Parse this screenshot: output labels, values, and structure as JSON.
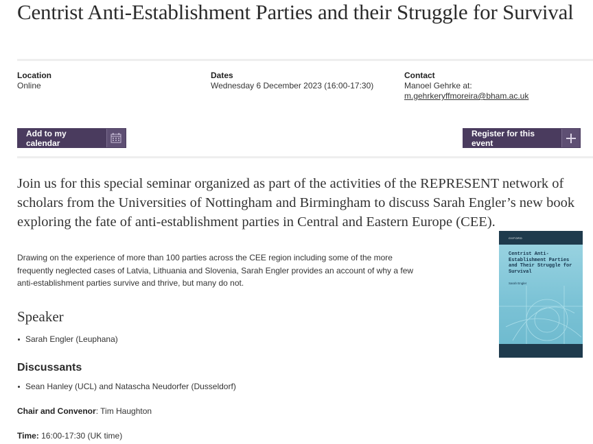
{
  "page": {
    "title": "Centrist Anti-Establishment Parties and their Struggle for Survival"
  },
  "meta": {
    "location_label": "Location",
    "location_value": "Online",
    "dates_label": "Dates",
    "dates_value": "Wednesday 6 December 2023 (16:00-17:30)",
    "contact_label": "Contact",
    "contact_name": "Manoel Gehrke at:",
    "contact_email": "m.gehrkeryffmoreira@bham.ac.uk"
  },
  "actions": {
    "calendar_label": "Add to my calendar",
    "calendar_icon": "calendar-icon",
    "register_label": "Register for this event",
    "register_icon": "plus-icon"
  },
  "content": {
    "lead": "Join us for this special seminar organized as part of the activities of the REPRESENT network of scholars from the Universities of Nottingham and Birmingham to discuss Sarah Engler’s new book exploring the fate of anti-establishment parties in Central and Eastern Europe (CEE).",
    "body": "Drawing on the experience of more than 100 parties across the CEE region including some of the more frequently neglected cases of Latvia, Lithuania and Slovenia, Sarah Engler provides an account of why a few anti-establishment parties survive and thrive, but many do not."
  },
  "book_cover": {
    "publisher": "OXFORD",
    "title": "Centrist Anti-Establishment Parties and Their Struggle for Survival",
    "author": "Sarah Engler",
    "series": "COMPARATIVE POLITICS"
  },
  "speaker": {
    "heading": "Speaker",
    "items": [
      "Sarah Engler (Leuphana)"
    ]
  },
  "discussants": {
    "heading": "Discussants",
    "items": [
      "Sean Hanley (UCL) and Natascha Neudorfer (Dusseldorf)"
    ]
  },
  "chair": {
    "label": "Chair and Convenor",
    "value": ": Tim Haughton"
  },
  "time": {
    "label": "Time:",
    "value": " 16:00-17:30 (UK time)"
  },
  "colors": {
    "button_bg": "#4a3b5e",
    "link": "#1a4d8c"
  }
}
